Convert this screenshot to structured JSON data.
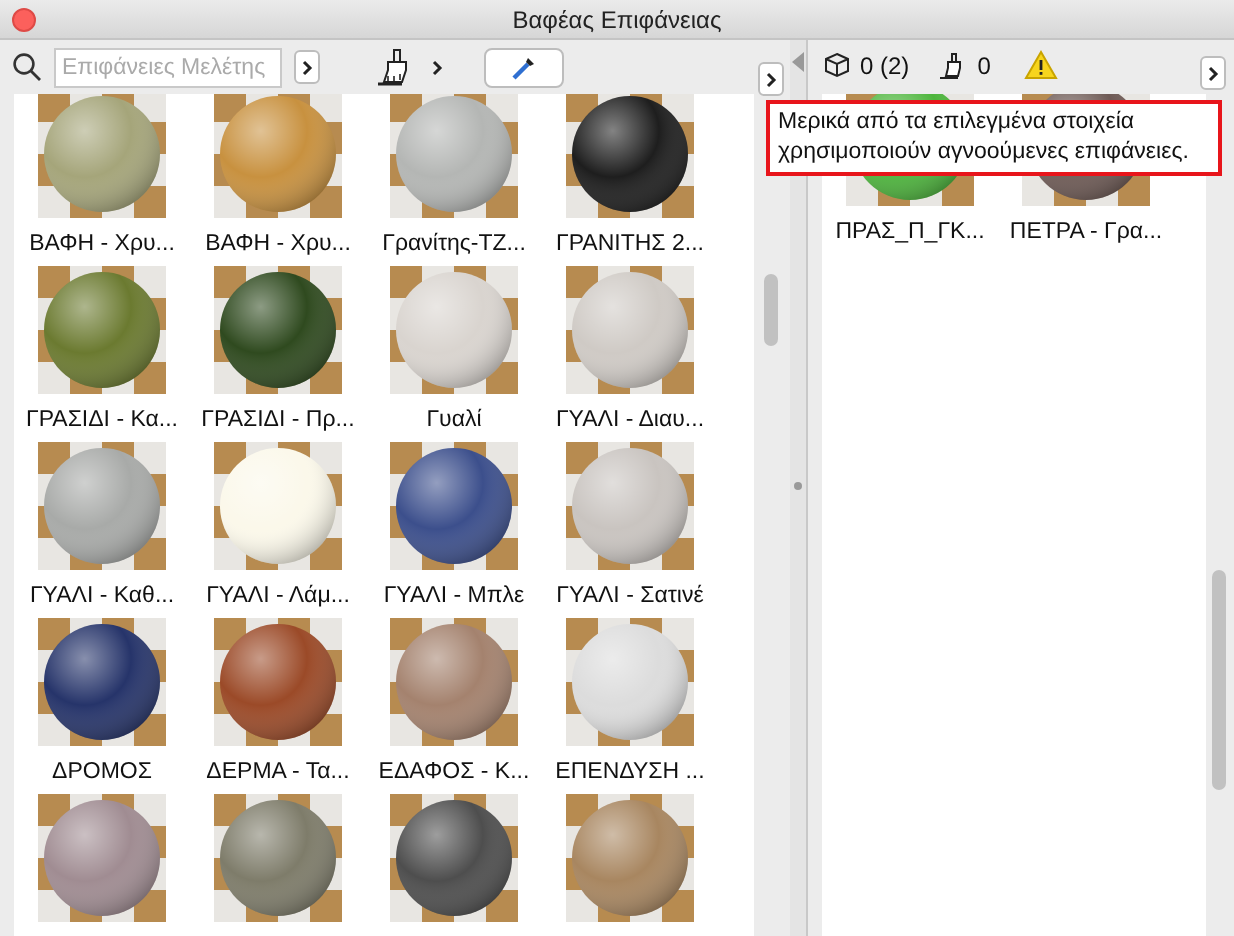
{
  "window": {
    "title": "Βαφέας Επιφάνειας"
  },
  "toolbar": {
    "search": {
      "placeholder": "Επιφάνειες Μελέτης"
    }
  },
  "surfaces": [
    {
      "name": "ΒΑΦΗ - Χρυ...",
      "color": "#a5a57a"
    },
    {
      "name": "ΒΑΦΗ - Χρυ...",
      "color": "#c8913f"
    },
    {
      "name": "Γρανίτης-ΤΖ...",
      "color": "#b4b6b4"
    },
    {
      "name": "ΓΡΑΝΙΤΗΣ 2...",
      "color": "#1e1e1e"
    },
    {
      "name": "ΓΡΑΣΙΔΙ - Κα...",
      "color": "#6b7a30"
    },
    {
      "name": "ΓΡΑΣΙΔΙ - Πρ...",
      "color": "#2f4a1f"
    },
    {
      "name": "Γυαλί",
      "color": "#d9d4cf"
    },
    {
      "name": "ΓΥΑΛΙ - Διαυ...",
      "color": "#cfcac5"
    },
    {
      "name": "ΓΥΑΛΙ - Καθ...",
      "color": "#a8aaa8"
    },
    {
      "name": "ΓΥΑΛΙ - Λάμ...",
      "color": "#fbf8ea"
    },
    {
      "name": "ΓΥΑΛΙ - Μπλε",
      "color": "#3c4f8c"
    },
    {
      "name": "ΓΥΑΛΙ - Σατινέ",
      "color": "#c9c4c0"
    },
    {
      "name": "ΔΡΟΜΟΣ",
      "color": "#26346a"
    },
    {
      "name": "ΔΕΡΜΑ - Τα...",
      "color": "#9b4a28"
    },
    {
      "name": "ΕΔΑΦΟΣ - Κ...",
      "color": "#a4826e"
    },
    {
      "name": "ΕΠΕΝΔΥΣΗ ...",
      "color": "#dcdcdc"
    },
    {
      "color": "#a08c92"
    },
    {
      "color": "#7e7c6a"
    },
    {
      "color": "#4e4e4e"
    },
    {
      "color": "#a88660"
    }
  ],
  "selection": {
    "elements_count": "0 (2)",
    "surfaces_count": "0"
  },
  "selected_surfaces": [
    {
      "name": "ΠΡΑΣ_Π_ΓΚ...",
      "color": "#4db53c"
    },
    {
      "name": "ΠΕΤΡΑ - Γρα...",
      "color": "#6e5a55"
    }
  ],
  "tooltip": {
    "text": "Μερικά από τα επιλεγμένα στοιχεία χρησιμοποιούν αγνοούμενες επιφάνειες."
  }
}
